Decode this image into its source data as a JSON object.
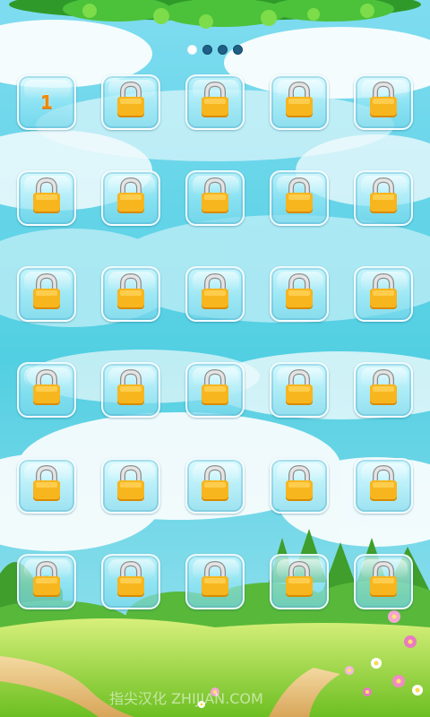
{
  "page_indicator": {
    "pages": 4,
    "current_page": 1
  },
  "levels": [
    {
      "label": "1",
      "locked": false
    },
    {
      "locked": true
    },
    {
      "locked": true
    },
    {
      "locked": true
    },
    {
      "locked": true
    },
    {
      "locked": true
    },
    {
      "locked": true
    },
    {
      "locked": true
    },
    {
      "locked": true
    },
    {
      "locked": true
    },
    {
      "locked": true
    },
    {
      "locked": true
    },
    {
      "locked": true
    },
    {
      "locked": true
    },
    {
      "locked": true
    },
    {
      "locked": true
    },
    {
      "locked": true
    },
    {
      "locked": true
    },
    {
      "locked": true
    },
    {
      "locked": true
    },
    {
      "locked": true
    },
    {
      "locked": true
    },
    {
      "locked": true
    },
    {
      "locked": true
    },
    {
      "locked": true
    },
    {
      "locked": true
    },
    {
      "locked": true
    },
    {
      "locked": true
    },
    {
      "locked": true
    },
    {
      "locked": true
    }
  ],
  "lock_icon": "padlock-icon",
  "watermark": "指尖汉化 ZHIJIAN.COM",
  "colors": {
    "sky": "#5fcfe0",
    "grass": "#8fd43a",
    "lock_body": "#f5b01c",
    "lock_shackle": "#c9c9c9",
    "dot_inactive": "#1f5f86",
    "dot_active": "#ffffff"
  }
}
